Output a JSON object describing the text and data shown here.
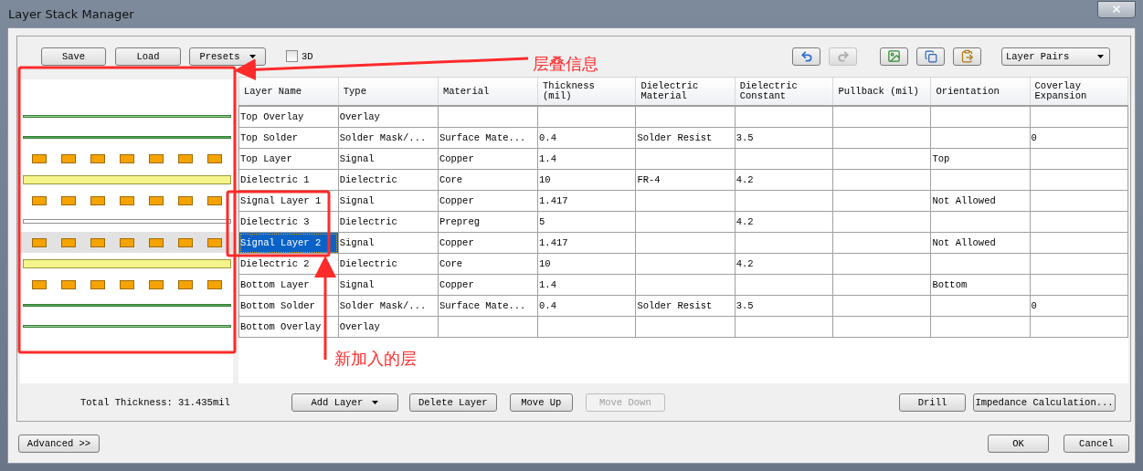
{
  "window": {
    "title": "Layer Stack Manager"
  },
  "toolbar": {
    "buttons": [
      {
        "label": "Save",
        "dropdown": false
      },
      {
        "label": "Load",
        "dropdown": false
      },
      {
        "label": "Presets",
        "dropdown": true
      }
    ],
    "checkbox": {
      "label": "3D",
      "checked": false
    },
    "icon_buttons": [
      {
        "kind": "undo",
        "disabled": false
      },
      {
        "kind": "redo",
        "disabled": true
      },
      {
        "kind": "image",
        "disabled": false
      },
      {
        "kind": "copy",
        "disabled": false
      },
      {
        "kind": "paste",
        "disabled": false
      }
    ],
    "dropdown": {
      "value": "Layer Pairs"
    }
  },
  "table": {
    "columns": [
      "Layer Name",
      "Type",
      "Material",
      "Thickness\n(mil)",
      "Dielectric\nMaterial",
      "Dielectric\nConstant",
      "Pullback (mil)",
      "Orientation",
      "Coverlay\nExpansion"
    ],
    "rows": [
      {
        "kind": "overlay",
        "selected": false,
        "cells": [
          "Top Overlay",
          "Overlay",
          "",
          "",
          "",
          "",
          "",
          "",
          ""
        ]
      },
      {
        "kind": "solder",
        "selected": false,
        "cells": [
          "Top Solder",
          "Solder Mask/...",
          "Surface Mate...",
          "0.4",
          "Solder Resist",
          "3.5",
          "",
          "",
          "0"
        ]
      },
      {
        "kind": "signal",
        "selected": false,
        "cells": [
          "Top Layer",
          "Signal",
          "Copper",
          "1.4",
          "",
          "",
          "",
          "Top",
          ""
        ]
      },
      {
        "kind": "core",
        "selected": false,
        "cells": [
          "Dielectric 1",
          "Dielectric",
          "Core",
          "10",
          "FR-4",
          "4.2",
          "",
          "",
          ""
        ]
      },
      {
        "kind": "signal",
        "selected": false,
        "cells": [
          "Signal Layer 1",
          "Signal",
          "Copper",
          "1.417",
          "",
          "",
          "",
          "Not Allowed",
          ""
        ]
      },
      {
        "kind": "prepreg",
        "selected": false,
        "cells": [
          "Dielectric 3",
          "Dielectric",
          "Prepreg",
          "5",
          "",
          "4.2",
          "",
          "",
          ""
        ]
      },
      {
        "kind": "signal",
        "selected": true,
        "cells": [
          "Signal Layer 2",
          "Signal",
          "Copper",
          "1.417",
          "",
          "",
          "",
          "Not Allowed",
          ""
        ]
      },
      {
        "kind": "core",
        "selected": false,
        "cells": [
          "Dielectric 2",
          "Dielectric",
          "Core",
          "10",
          "",
          "4.2",
          "",
          "",
          ""
        ]
      },
      {
        "kind": "signal",
        "selected": false,
        "cells": [
          "Bottom Layer",
          "Signal",
          "Copper",
          "1.4",
          "",
          "",
          "",
          "Bottom",
          ""
        ]
      },
      {
        "kind": "solder",
        "selected": false,
        "cells": [
          "Bottom Solder",
          "Solder Mask/...",
          "Surface Mate...",
          "0.4",
          "Solder Resist",
          "3.5",
          "",
          "",
          "0"
        ]
      },
      {
        "kind": "overlay",
        "selected": false,
        "cells": [
          "Bottom Overlay",
          "Overlay",
          "",
          "",
          "",
          "",
          "",
          "",
          ""
        ]
      }
    ]
  },
  "footer": {
    "total": "Total Thickness: 31.435mil",
    "buttons": [
      {
        "label": "Add Layer",
        "dropdown": true,
        "disabled": false
      },
      {
        "label": "Delete Layer",
        "dropdown": false,
        "disabled": false
      },
      {
        "label": "Move Up",
        "dropdown": false,
        "disabled": false
      },
      {
        "label": "Move Down",
        "dropdown": false,
        "disabled": true
      }
    ],
    "right_buttons": [
      "Drill",
      "Impedance Calculation..."
    ]
  },
  "dialog_buttons": {
    "advanced": "Advanced >>",
    "ok": "OK",
    "cancel": "Cancel"
  },
  "annotations": [
    {
      "text": "层叠信息"
    },
    {
      "text": "新加入的层"
    }
  ]
}
